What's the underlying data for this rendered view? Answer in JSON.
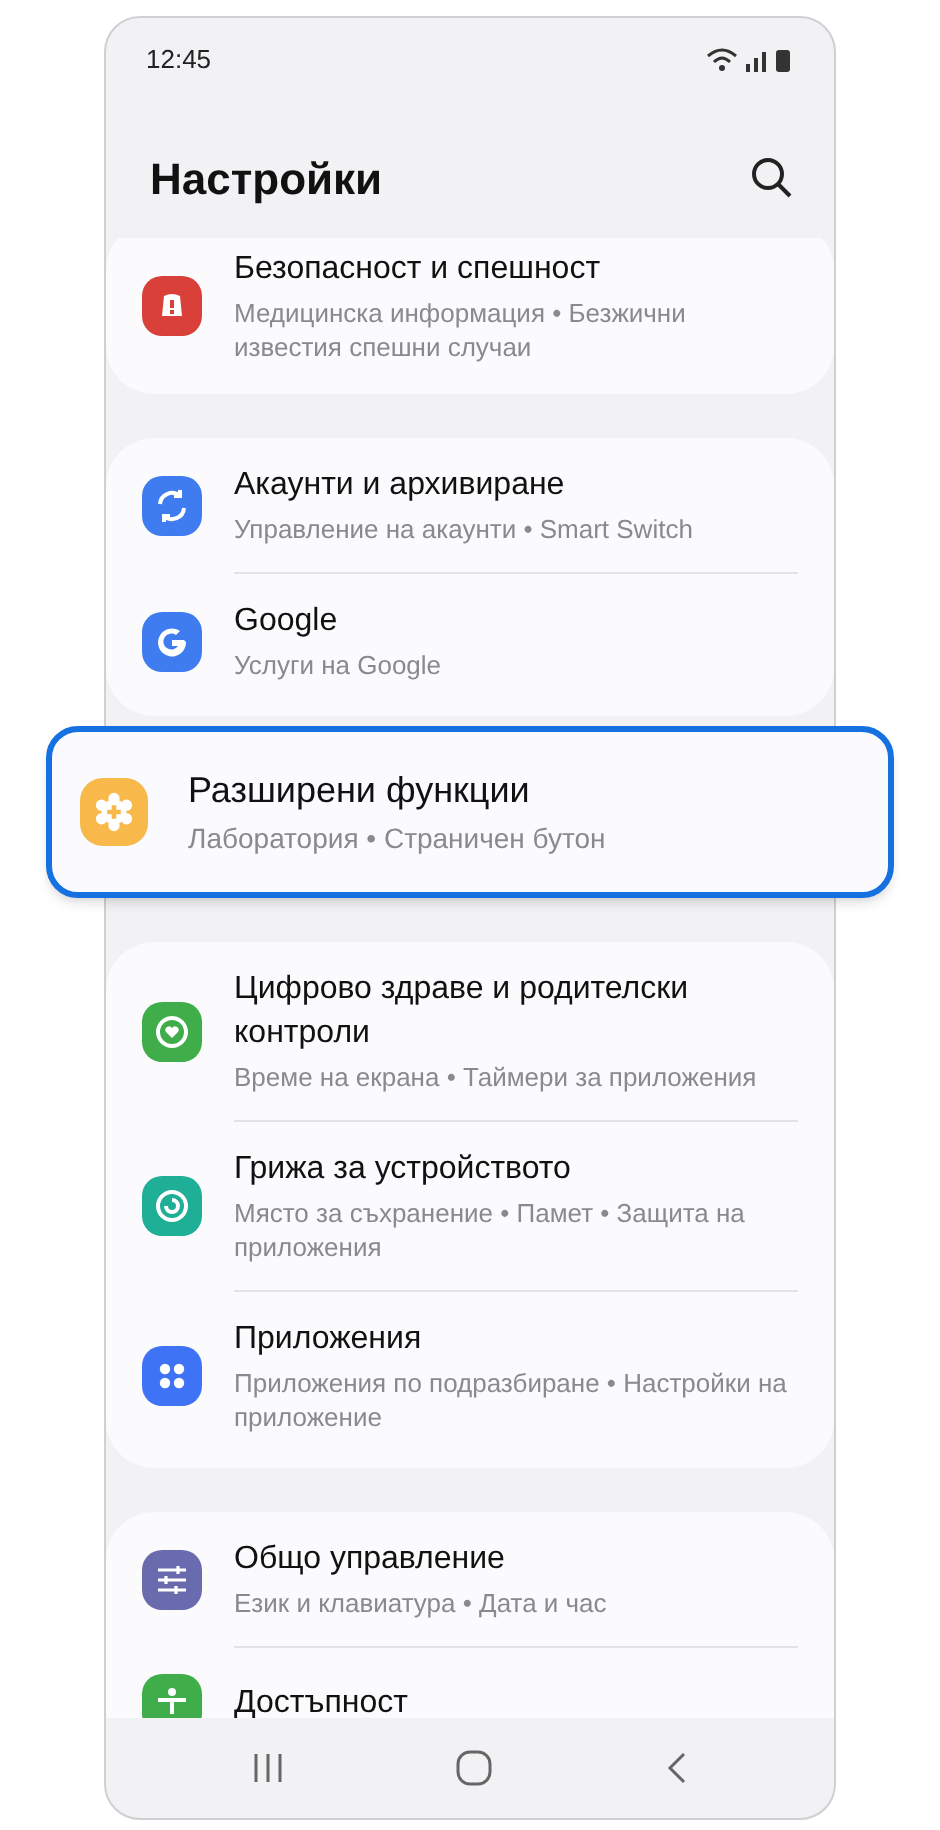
{
  "status_bar": {
    "time": "12:45"
  },
  "header": {
    "title": "Настройки"
  },
  "groups": [
    {
      "highlighted": false,
      "items": [
        {
          "title": "Безопасност и спешност",
          "subtitle": "Медицинска информация  •  Безжични известия спешни случаи",
          "kind": "alert",
          "color": "#d9403a"
        }
      ]
    },
    {
      "highlighted": false,
      "items": [
        {
          "title": "Акаунти и архивиране",
          "subtitle": "Управление на акаунти  •  Smart Switch",
          "kind": "sync",
          "color": "#3f7cf0"
        },
        {
          "title": "Google",
          "subtitle": "Услуги на Google",
          "kind": "google",
          "color": "#3f7cf0"
        }
      ]
    },
    {
      "highlighted": true,
      "items": [
        {
          "title": "Разширени функции",
          "subtitle": "Лаборатория  •  Страничен бутон",
          "kind": "gear",
          "color": "#f8b84a"
        }
      ]
    },
    {
      "highlighted": false,
      "items": [
        {
          "title": "Цифрово здраве и родителски контроли",
          "subtitle": "Време на екрана  •  Таймери за приложения",
          "kind": "heart",
          "color": "#3fae4a"
        },
        {
          "title": "Грижа за устройството",
          "subtitle": "Място за съхранение  •  Памет  •  Защита на приложения",
          "kind": "care",
          "color": "#1fae96"
        },
        {
          "title": "Приложения",
          "subtitle": "Приложения по подразбиране  •  Настройки на приложение",
          "kind": "apps",
          "color": "#3f73f5"
        }
      ]
    },
    {
      "highlighted": false,
      "items": [
        {
          "title": "Общо управление",
          "subtitle": "Език и клавиатура  •  Дата и час",
          "kind": "sliders",
          "color": "#6a6aae"
        },
        {
          "title": "Достъпност",
          "kind": "person",
          "color": "#3fae4a"
        }
      ]
    }
  ]
}
